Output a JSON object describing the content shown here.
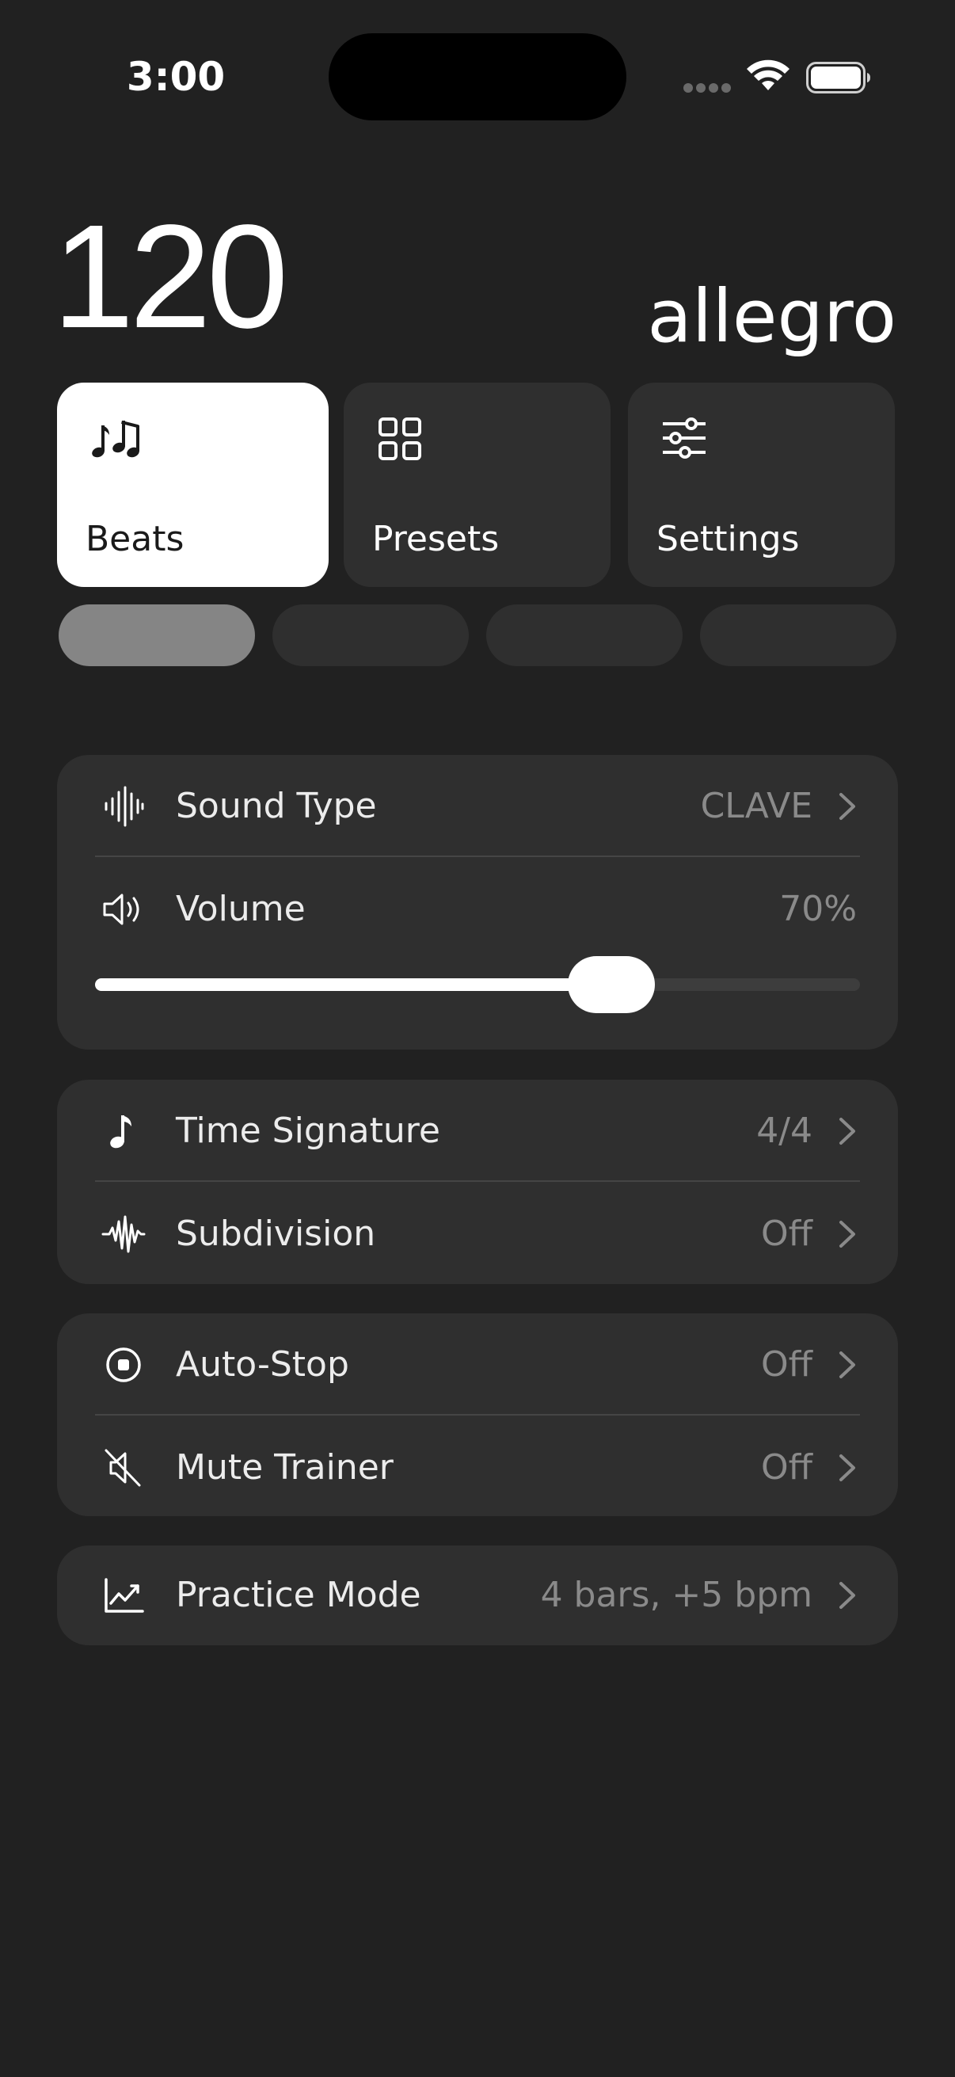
{
  "status_bar": {
    "time": "3:00"
  },
  "tempo": {
    "bpm": "120",
    "name": "allegro"
  },
  "tiles": [
    {
      "label": "Beats",
      "icon": "music-notes-icon",
      "active": true
    },
    {
      "label": "Presets",
      "icon": "grid-icon",
      "active": false
    },
    {
      "label": "Settings",
      "icon": "sliders-icon",
      "active": false
    }
  ],
  "page_indicator": {
    "count": 4,
    "active_index": 0
  },
  "sound_card": {
    "sound_type": {
      "label": "Sound Type",
      "value": "CLAVE",
      "icon": "waveform-icon"
    },
    "volume": {
      "label": "Volume",
      "value": "70%",
      "icon": "speaker-icon",
      "level": 0.675
    }
  },
  "rhythm_card": {
    "time_signature": {
      "label": "Time Signature",
      "value": "4/4",
      "icon": "music-note-icon"
    },
    "subdivision": {
      "label": "Subdivision",
      "value": "Off",
      "icon": "pulse-wave-icon"
    }
  },
  "trainer_card": {
    "auto_stop": {
      "label": "Auto-Stop",
      "value": "Off",
      "icon": "stop-circle-icon"
    },
    "mute_trainer": {
      "label": "Mute Trainer",
      "value": "Off",
      "icon": "speaker-muted-icon"
    }
  },
  "practice_card": {
    "practice_mode": {
      "label": "Practice Mode",
      "value": "4 bars, +5 bpm",
      "icon": "trending-chart-icon"
    }
  },
  "colors": {
    "background": "#212121",
    "card": "#2f2f2f",
    "active_tile": "#ffffff",
    "secondary_text": "#8a8a8a"
  }
}
